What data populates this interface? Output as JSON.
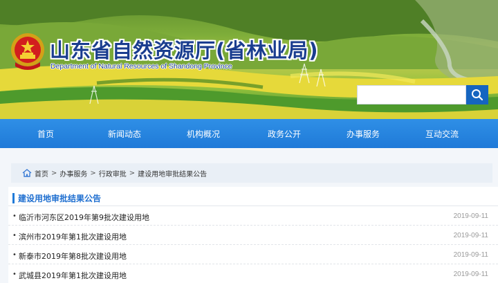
{
  "header": {
    "title": "山东省自然资源厅(省林业局)",
    "subtitle": "Department of Natural Resources of Shandong Province"
  },
  "search": {
    "placeholder": ""
  },
  "nav": [
    {
      "label": "首页"
    },
    {
      "label": "新闻动态"
    },
    {
      "label": "机构概况"
    },
    {
      "label": "政务公开"
    },
    {
      "label": "办事服务"
    },
    {
      "label": "互动交流"
    }
  ],
  "breadcrumb": {
    "items": [
      "首页",
      "办事服务",
      "行政审批",
      "建设用地审批结果公告"
    ]
  },
  "section": {
    "title": "建设用地审批结果公告"
  },
  "list": [
    {
      "text": "临沂市河东区2019年第9批次建设用地",
      "date": "2019-09-11"
    },
    {
      "text": "滨州市2019年第1批次建设用地",
      "date": "2019-09-11"
    },
    {
      "text": "新泰市2019年第8批次建设用地",
      "date": "2019-09-11"
    },
    {
      "text": "武城县2019年第1批次建设用地",
      "date": "2019-09-11"
    }
  ],
  "colors": {
    "nav": "#1f7ad8",
    "title": "#1a3d8f",
    "accent": "#1f6fd0"
  },
  "icons": {
    "search": "search-icon",
    "home": "home-icon",
    "emblem": "national-emblem-icon"
  }
}
